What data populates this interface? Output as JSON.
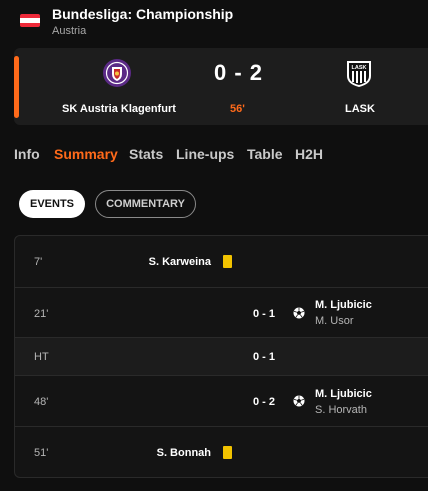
{
  "league": {
    "title": "Bundesliga: Championship",
    "country": "Austria",
    "flag_colors": [
      "#ed2939",
      "#ffffff",
      "#ed2939"
    ]
  },
  "match": {
    "home_team": "SK Austria Klagenfurt",
    "away_team": "LASK",
    "score": "0 - 2",
    "minute": "56'",
    "home_logo_icon": "austria-klagenfurt-crest-icon",
    "away_logo_icon": "lask-crest-icon"
  },
  "tabs": [
    "Info",
    "Summary",
    "Stats",
    "Line-ups",
    "Table",
    "H2H"
  ],
  "active_tab": "Summary",
  "filters": {
    "events": "EVENTS",
    "commentary": "COMMENTARY"
  },
  "events": [
    {
      "minute": "7'",
      "player": "S. Karweina",
      "type": "yellow-card",
      "side": "home"
    },
    {
      "minute": "21'",
      "score": "0 - 1",
      "scorer": "M. Ljubicic",
      "assist": "M. Usor",
      "type": "goal",
      "side": "away"
    },
    {
      "minute": "HT",
      "score": "0 - 1",
      "type": "half-time"
    },
    {
      "minute": "48'",
      "score": "0 - 2",
      "scorer": "M. Ljubicic",
      "assist": "S. Horvath",
      "type": "goal",
      "side": "away"
    },
    {
      "minute": "51'",
      "player": "S. Bonnah",
      "type": "yellow-card",
      "side": "home"
    }
  ],
  "colors": {
    "accent": "#ff6a1a",
    "yellow_card": "#f2c300",
    "background": "#0f0f0f",
    "card_bg": "#1d1d1d"
  }
}
